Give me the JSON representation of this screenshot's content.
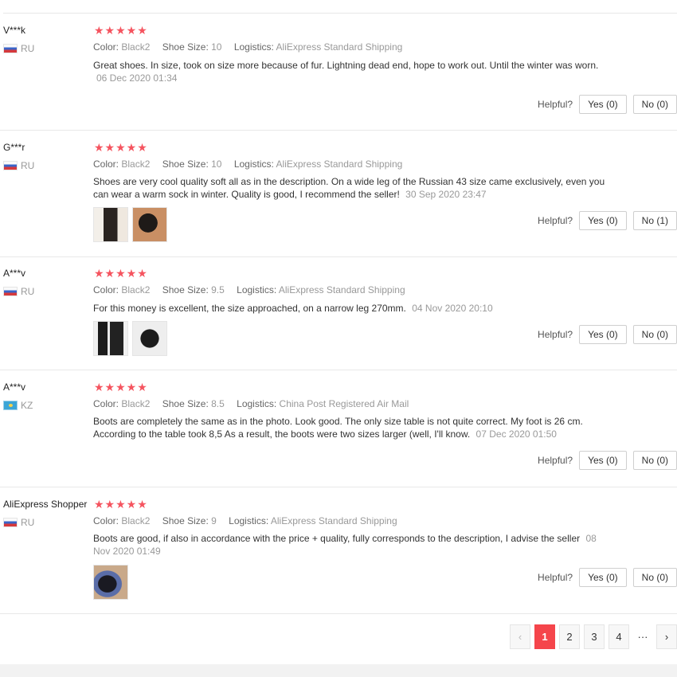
{
  "reviews": [
    {
      "user": "V***k",
      "country": "RU",
      "stars": "★★★★★",
      "color_label": "Color:",
      "color": "Black2",
      "size_label": "Shoe Size:",
      "size": "10",
      "logistics_label": "Logistics:",
      "logistics": "AliExpress Standard Shipping",
      "text": "Great shoes. In size, took on size more because of fur. Lightning dead end, hope to work out. Until the winter was worn.",
      "date": "06 Dec 2020 01:34",
      "helpful_label": "Helpful?",
      "yes": "Yes (0)",
      "no": "No (0)"
    },
    {
      "user": "G***r",
      "country": "RU",
      "stars": "★★★★★",
      "color_label": "Color:",
      "color": "Black2",
      "size_label": "Shoe Size:",
      "size": "10",
      "logistics_label": "Logistics:",
      "logistics": "AliExpress Standard Shipping",
      "text": "Shoes are very cool quality soft all as in the description. On a wide leg of the Russian 43 size came exclusively, even you can wear a warm sock in winter. Quality is good, I recommend the seller!",
      "date": "30 Sep 2020 23:47",
      "helpful_label": "Helpful?",
      "yes": "Yes (0)",
      "no": "No (1)"
    },
    {
      "user": "A***v",
      "country": "RU",
      "stars": "★★★★★",
      "color_label": "Color:",
      "color": "Black2",
      "size_label": "Shoe Size:",
      "size": "9.5",
      "logistics_label": "Logistics:",
      "logistics": "AliExpress Standard Shipping",
      "text": "For this money is excellent, the size approached, on a narrow leg 270mm.",
      "date": "04 Nov 2020 20:10",
      "helpful_label": "Helpful?",
      "yes": "Yes (0)",
      "no": "No (0)"
    },
    {
      "user": "A***v",
      "country": "KZ",
      "stars": "★★★★★",
      "color_label": "Color:",
      "color": "Black2",
      "size_label": "Shoe Size:",
      "size": "8.5",
      "logistics_label": "Logistics:",
      "logistics": "China Post Registered Air Mail",
      "text": "Boots are completely the same as in the photo. Look good. The only size table is not quite correct. My foot is 26 cm. According to the table took 8,5 As a result, the boots were two sizes larger (well, I'll know.",
      "date": "07 Dec 2020 01:50",
      "helpful_label": "Helpful?",
      "yes": "Yes (0)",
      "no": "No (0)"
    },
    {
      "user": "AliExpress Shopper",
      "country": "RU",
      "stars": "★★★★★",
      "color_label": "Color:",
      "color": "Black2",
      "size_label": "Shoe Size:",
      "size": "9",
      "logistics_label": "Logistics:",
      "logistics": "AliExpress Standard Shipping",
      "text": "Boots are good, if also in accordance with the price + quality, fully corresponds to the description, I advise the seller",
      "date": "08 Nov 2020 01:49",
      "helpful_label": "Helpful?",
      "yes": "Yes (0)",
      "no": "No (0)"
    }
  ],
  "pagination": {
    "prev": "‹",
    "pages": [
      "1",
      "2",
      "3",
      "4"
    ],
    "ellipsis": "···",
    "next": "›",
    "current": "1"
  },
  "colors": {
    "star": "#f5545f",
    "active_page": "#f5454b"
  }
}
